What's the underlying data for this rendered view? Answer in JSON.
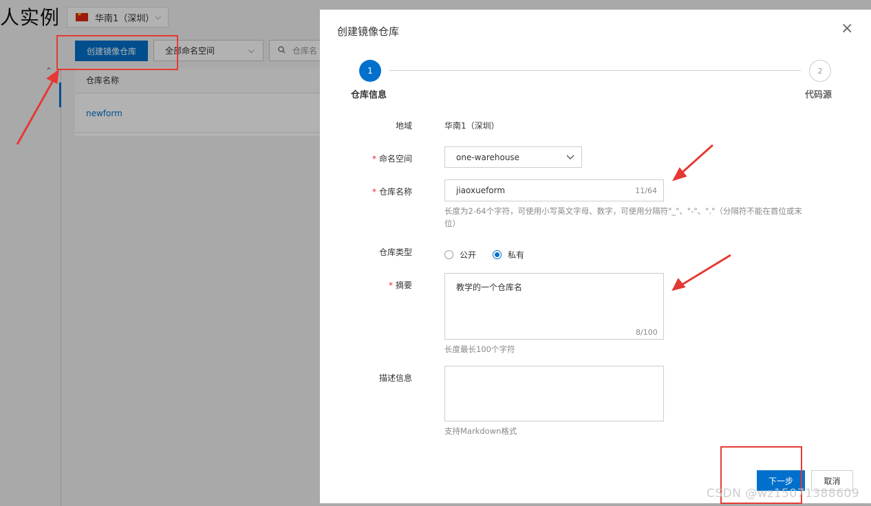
{
  "background": {
    "page_title": "人实例",
    "region": "华南1（深圳）",
    "create_button": "创建镜像仓库",
    "namespace_filter": "全部命名空间",
    "search_placeholder": "仓库名",
    "table": {
      "column_header": "仓库名称",
      "rows": [
        "newform"
      ]
    }
  },
  "modal": {
    "title": "创建镜像仓库",
    "close": "×",
    "steps": [
      {
        "number": "1",
        "label": "仓库信息",
        "active": true
      },
      {
        "number": "2",
        "label": "代码源",
        "active": false
      }
    ],
    "form": {
      "region_label": "地域",
      "region_value": "华南1（深圳）",
      "namespace_label": "命名空间",
      "namespace_value": "one-warehouse",
      "repo_name_label": "仓库名称",
      "repo_name_value": "jiaoxueform",
      "repo_name_counter": "11/64",
      "repo_name_hint": "长度为2-64个字符，可使用小写英文字母、数字，可使用分隔符\"_\"、\"-\"、\".\"（分隔符不能在首位或末位）",
      "repo_type_label": "仓库类型",
      "repo_type_options": [
        "公开",
        "私有"
      ],
      "repo_type_selected": "私有",
      "summary_label": "摘要",
      "summary_value": "教学的一个仓库名",
      "summary_counter": "8/100",
      "summary_hint": "长度最长100个字符",
      "description_label": "描述信息",
      "description_value": "",
      "description_hint": "支持Markdown格式"
    },
    "footer": {
      "next_button": "下一步",
      "cancel_button": "取消"
    }
  },
  "watermark": "CSDN @wz15071388609",
  "colors": {
    "primary": "#0070cc",
    "required_mark": "#e23333",
    "annotation": "#e53935"
  }
}
